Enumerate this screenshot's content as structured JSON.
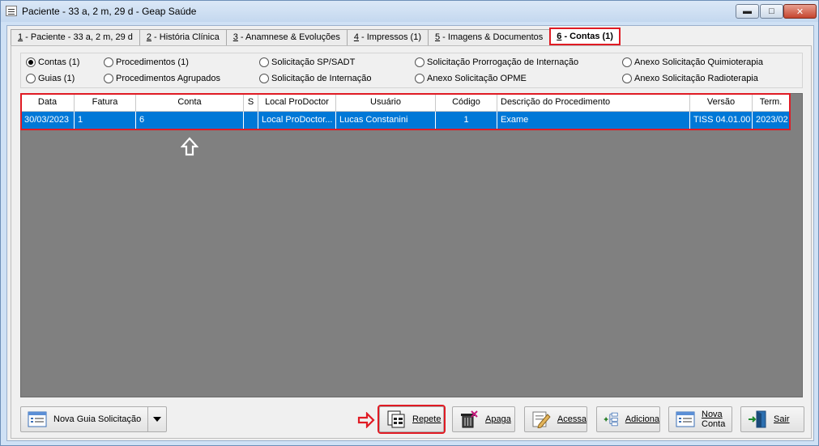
{
  "window": {
    "title": "Paciente - 33 a, 2 m, 29 d - Geap Saúde",
    "controls": {
      "minimize": "▬",
      "maximize": "□",
      "close": "✕"
    }
  },
  "tabs": [
    {
      "key": "1",
      "label": " - Paciente - 33 a, 2 m, 29 d"
    },
    {
      "key": "2",
      "label": " - História Clínica"
    },
    {
      "key": "3",
      "label": " - Anamnese & Evoluções"
    },
    {
      "key": "4",
      "label": " - Impressos  (1)"
    },
    {
      "key": "5",
      "label": " - Imagens & Documentos"
    },
    {
      "key": "6",
      "label": " - Contas  (1)",
      "active": true
    }
  ],
  "filters": {
    "contas": "Contas (1)",
    "guias": "Guias (1)",
    "procedimentos": "Procedimentos (1)",
    "procedimentos_agrupados": "Procedimentos Agrupados",
    "solicitacao_sp_sadt": "Solicitação SP/SADT",
    "solicitacao_internacao": "Solicitação de Internação",
    "solicitacao_prorrogacao": "Solicitação Prorrogação de Internação",
    "anexo_opme": "Anexo Solicitação OPME",
    "anexo_quimioterapia": "Anexo Solicitação Quimioterapia",
    "anexo_radioterapia": "Anexo Solicitação Radioterapia",
    "selected": "contas"
  },
  "grid": {
    "columns": [
      "Data",
      "Fatura",
      "Conta",
      "S",
      "Local ProDoctor",
      "Usuário",
      "Código",
      "Descrição do Procedimento",
      "Versão",
      "Term."
    ],
    "rows": [
      [
        "30/03/2023",
        "1",
        "6",
        "",
        "Local ProDoctor...",
        "Lucas Constanini",
        "1",
        "Exame",
        "TISS 04.01.00",
        "2023/02"
      ]
    ],
    "selected_row": 0
  },
  "toolbar": {
    "nova_guia": "Nova Guia Solicitação",
    "repete": "Repete",
    "apaga": "Apaga",
    "acessa": "Acessa",
    "adiciona": "Adiciona",
    "nova_conta_1": "Nova",
    "nova_conta_2": "Conta",
    "sair": "Sair"
  },
  "colors": {
    "highlight_red": "#e01b24",
    "selection_blue": "#0078d7",
    "grid_background": "#808080"
  }
}
